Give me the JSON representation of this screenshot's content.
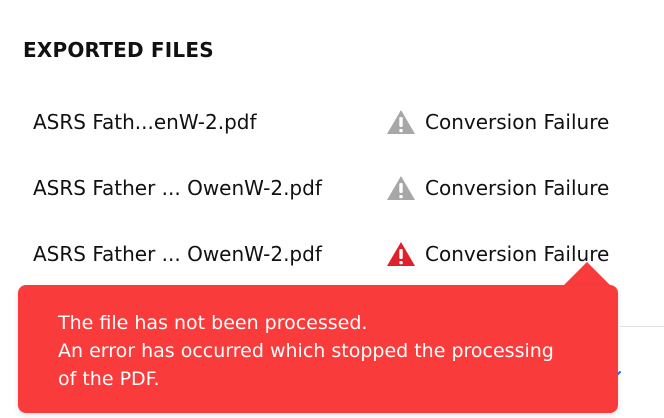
{
  "section": {
    "title": "EXPORTED FILES"
  },
  "files": [
    {
      "name": "ASRS Fath...enW-2.pdf",
      "status": "Conversion Failure",
      "icon": "warning-triangle-icon",
      "icon_color": "#a7a7a7"
    },
    {
      "name": "ASRS Father ... OwenW-2.pdf",
      "status": "Conversion Failure",
      "icon": "warning-triangle-icon",
      "icon_color": "#a7a7a7"
    },
    {
      "name": "ASRS Father ... OwenW-2.pdf",
      "status": "Conversion Failure",
      "icon": "warning-triangle-icon",
      "icon_color": "#e0202b"
    }
  ],
  "tooltip": {
    "line1": "The file has not been processed.",
    "line2": "An error has occurred which stopped the processing",
    "line3": "of the PDF.",
    "background": "#fa3b3b"
  },
  "colors": {
    "text": "#111111",
    "warning_gray": "#a7a7a7",
    "warning_red": "#e0202b",
    "link_blue": "#2d6fe0"
  }
}
